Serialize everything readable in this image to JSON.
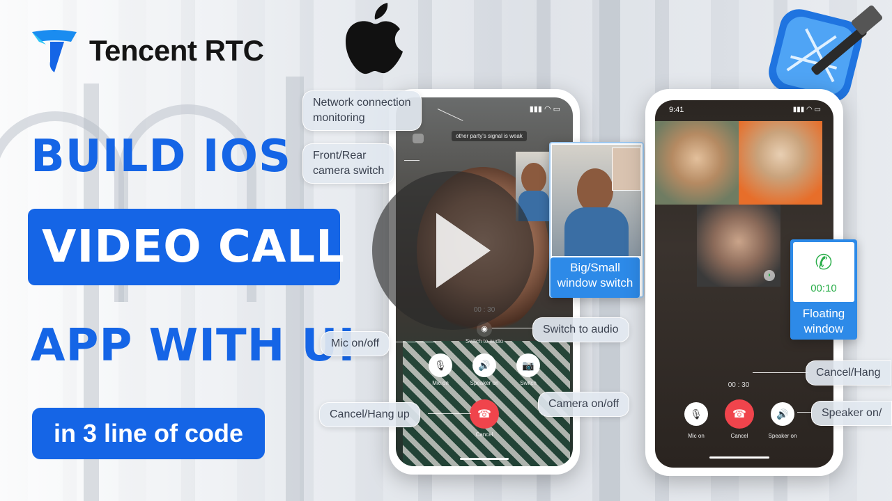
{
  "brand": {
    "name": "Tencent RTC"
  },
  "headline": {
    "line1": "BUILD IOS",
    "line2": "VIDEO CALL",
    "line3": "APP WITH UI",
    "badge": "in 3 line of code"
  },
  "phone1": {
    "signal_banner": "other party's signal is weak",
    "timer": "00 : 30",
    "switch_audio_label": "Switch to audio",
    "controls": [
      {
        "label": "Mic on",
        "icon": "mic-icon"
      },
      {
        "label": "Speaker on",
        "icon": "speaker-icon"
      },
      {
        "label": "Switch",
        "icon": "camera-icon"
      }
    ],
    "hangup_label": "Cancel"
  },
  "phone2": {
    "time": "9:41",
    "timer": "00 : 30",
    "controls": [
      {
        "label": "Mic on",
        "icon": "mic-icon"
      },
      {
        "label": "Cancel",
        "icon": "hangup-icon"
      },
      {
        "label": "Speaker on",
        "icon": "speaker-icon"
      }
    ]
  },
  "callouts": {
    "network": "Network connection\nmonitoring",
    "camera_switch": "Front/Rear\ncamera switch",
    "big_small": "Big/Small\nwindow switch",
    "switch_audio": "Switch to audio",
    "mic": "Mic on/off",
    "camera_onoff": "Camera on/off",
    "hangup": "Cancel/Hang up",
    "hang_right": "Cancel/Hang",
    "speaker_right": "Speaker on/",
    "floating": "Floating\nwindow",
    "floating_timer": "00:10"
  },
  "colors": {
    "accent": "#1565e6",
    "hangup": "#f0444c",
    "float_green": "#2aae4a"
  }
}
